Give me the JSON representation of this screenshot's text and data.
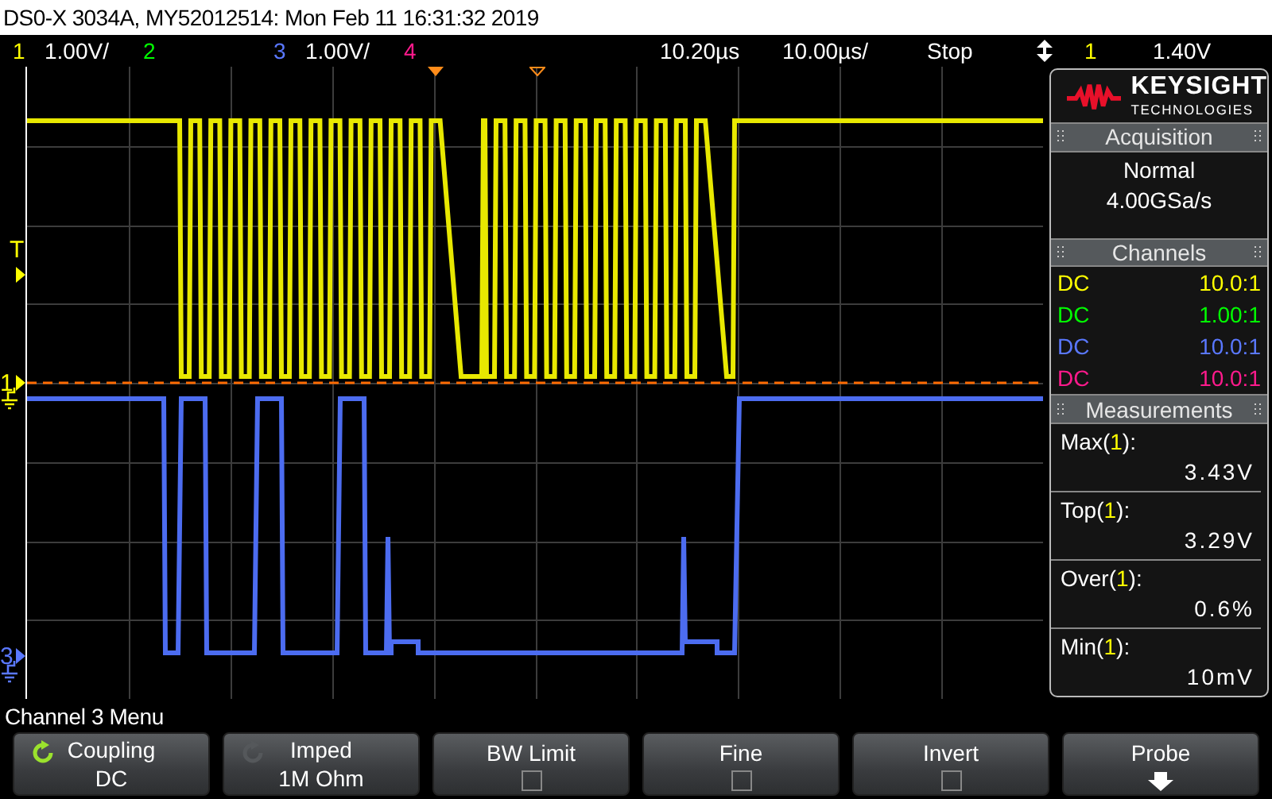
{
  "title_bar": {
    "text": "DS0-X 3034A, MY52012514: Mon Feb 11 16:31:32 2019"
  },
  "status_bar": {
    "channels": [
      {
        "number": "1",
        "scale": "1.00V/",
        "color": "#ffff00"
      },
      {
        "number": "2",
        "color": "#00ff00"
      },
      {
        "number": "3",
        "scale": "1.00V/",
        "color": "#5a78ff"
      },
      {
        "number": "4",
        "color": "#ff1a8c"
      }
    ],
    "delay": "10.20µs",
    "timebase": "10.00µs/",
    "run_state": "Stop",
    "trigger_source": {
      "text": "1",
      "color": "#ffff00"
    },
    "trigger_level": "1.40V"
  },
  "screen": {
    "markers": [
      {
        "kind": "trigger",
        "text": "T",
        "color": "#ffff00"
      },
      {
        "kind": "channel",
        "text": "1",
        "color": "#ffff00"
      },
      {
        "kind": "channel",
        "text": "3",
        "color": "#5a78ff"
      }
    ]
  },
  "side_panel": {
    "logo": {
      "name": "KEYSIGHT",
      "subtitle": "TECHNOLOGIES"
    },
    "acquisition": {
      "title": "Acquisition",
      "mode": "Normal",
      "rate": "4.00GSa/s"
    },
    "channels": {
      "title": "Channels",
      "rows": [
        {
          "coupling": "DC",
          "probe": "10.0:1",
          "color": "#ffff00"
        },
        {
          "coupling": "DC",
          "probe": "1.00:1",
          "color": "#00ff00"
        },
        {
          "coupling": "DC",
          "probe": "10.0:1",
          "color": "#5a78ff"
        },
        {
          "coupling": "DC",
          "probe": "10.0:1",
          "color": "#ff1a8c"
        }
      ]
    },
    "measurements": {
      "title": "Measurements",
      "items": [
        {
          "label": "Max(",
          "source": "1",
          "label_end": "):",
          "value": "3.43V"
        },
        {
          "label": "Top(",
          "source": "1",
          "label_end": "):",
          "value": "3.29V"
        },
        {
          "label": "Over(",
          "source": "1",
          "label_end": "):",
          "value": "0.6%"
        },
        {
          "label": "Min(",
          "source": "1",
          "label_end": "):",
          "value": "10mV"
        }
      ]
    }
  },
  "menu": {
    "title": "Channel 3 Menu",
    "softkeys": [
      {
        "kind": "cycle",
        "label": "Coupling",
        "value": "DC",
        "active": true
      },
      {
        "kind": "cycle",
        "label": "Imped",
        "value": "1M Ohm",
        "active": false
      },
      {
        "kind": "checkbox",
        "label": "BW Limit",
        "checked": false
      },
      {
        "kind": "checkbox",
        "label": "Fine",
        "checked": false
      },
      {
        "kind": "checkbox",
        "label": "Invert",
        "checked": false
      },
      {
        "kind": "submenu",
        "label": "Probe"
      }
    ]
  }
}
